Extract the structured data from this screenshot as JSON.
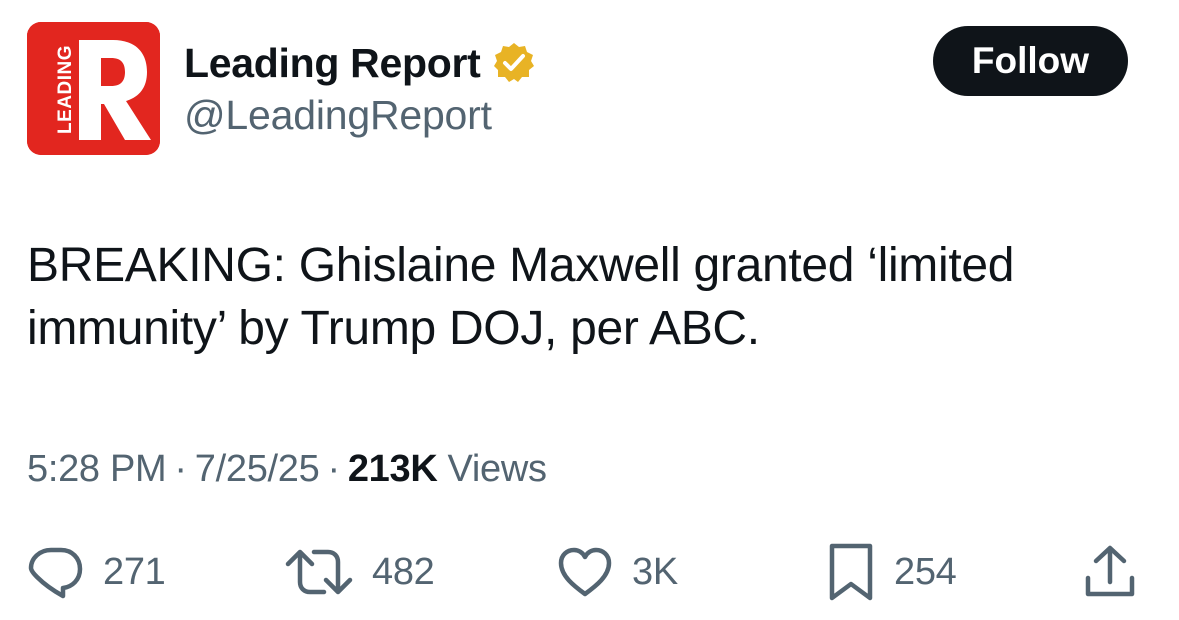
{
  "account": {
    "display_name": "Leading Report",
    "handle": "@LeadingReport",
    "verified": true,
    "avatar_text": "LEADING",
    "avatar_letter": "R",
    "avatar_color": "#e2261f",
    "badge_color": "#e8b325"
  },
  "follow_button": {
    "label": "Follow"
  },
  "tweet": {
    "text": "BREAKING: Ghislaine Maxwell granted ‘limited immunity’ by Trump DOJ, per ABC.",
    "time": "5:28 PM",
    "date": "7/25/25",
    "views_count": "213K",
    "views_label": "Views",
    "separator": "·"
  },
  "actions": {
    "replies": "271",
    "reposts": "482",
    "likes": "3K",
    "bookmarks": "254"
  },
  "icons": {
    "reply": "reply-icon",
    "repost": "repost-icon",
    "like": "heart-icon",
    "bookmark": "bookmark-icon",
    "share": "share-icon",
    "verified": "verified-badge-icon"
  },
  "colors": {
    "text_primary": "#0f1419",
    "text_secondary": "#536471",
    "follow_bg": "#0f1419"
  }
}
